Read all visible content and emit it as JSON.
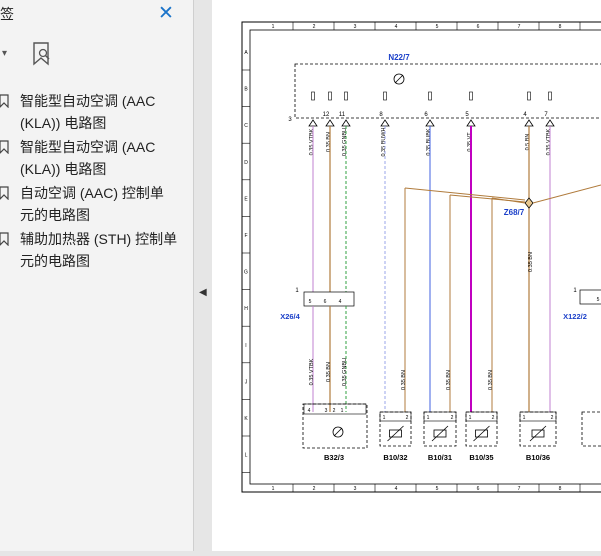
{
  "sidebar": {
    "title_fragment": "签",
    "close_glyph": "✕",
    "dropdown_glyph": "▾",
    "items": [
      {
        "line1": "智能型自动空调 (AAC",
        "line2": "(KLA)) 电路图"
      },
      {
        "line1": "智能型自动空调 (AAC",
        "line2": "(KLA)) 电路图"
      },
      {
        "line1": "自动空调 (AAC) 控制单",
        "line2": "元的电路图"
      },
      {
        "line1": "辅助加热器 (STH) 控制单",
        "line2": "元的电路图"
      }
    ],
    "collapse_glyph": "◀"
  },
  "diagram": {
    "col_numbers": [
      "1",
      "2",
      "3",
      "4",
      "5",
      "6",
      "7",
      "8"
    ],
    "row_letters": [
      "A",
      "B",
      "C",
      "D",
      "E",
      "F",
      "G",
      "H",
      "I",
      "J",
      "K",
      "L"
    ],
    "components": {
      "n22": "N22/7",
      "z68": "Z68/7",
      "x26": "X26/4",
      "x122": "X122/2",
      "b32": "B32/3",
      "b10_32": "B10/32",
      "b10_31": "B10/31",
      "b10_35": "B10/35",
      "b10_36": "B10/36"
    },
    "n22_pins": [
      "3",
      "12",
      "11",
      "8",
      "6",
      "5",
      "4",
      "7"
    ],
    "wires_top": [
      "0.35 VTBK",
      "0.35 BN",
      "0.35 GNBU",
      "0.35 BUWH",
      "0.35 BUBK",
      "0.35 VT",
      "0.5 BN",
      "0.35 VTBK"
    ],
    "z68_wire": "0.35 BN",
    "x26_pins": [
      "1",
      "5",
      "6",
      "4"
    ],
    "x122_pins": [
      "1",
      "5"
    ],
    "wires_bottom": [
      "0.35 VTBK",
      "0.35 BN",
      "0.35 GNBU",
      "0.35 BN",
      "0.35 BN",
      "0.35 BN"
    ],
    "b32_pins": [
      "4",
      "3",
      "2",
      "1"
    ],
    "sensor_pins": [
      "1",
      "2"
    ]
  },
  "colors": {
    "brand_blue": "#1a73c9",
    "wire_vt": "#c000c0",
    "wire_bn": "#b07b3c",
    "wire_bu": "#4060e0",
    "wire_gn": "#30a040",
    "wire_vtbk": "#c080d0",
    "wire_buwh": "#9aa4e8"
  }
}
